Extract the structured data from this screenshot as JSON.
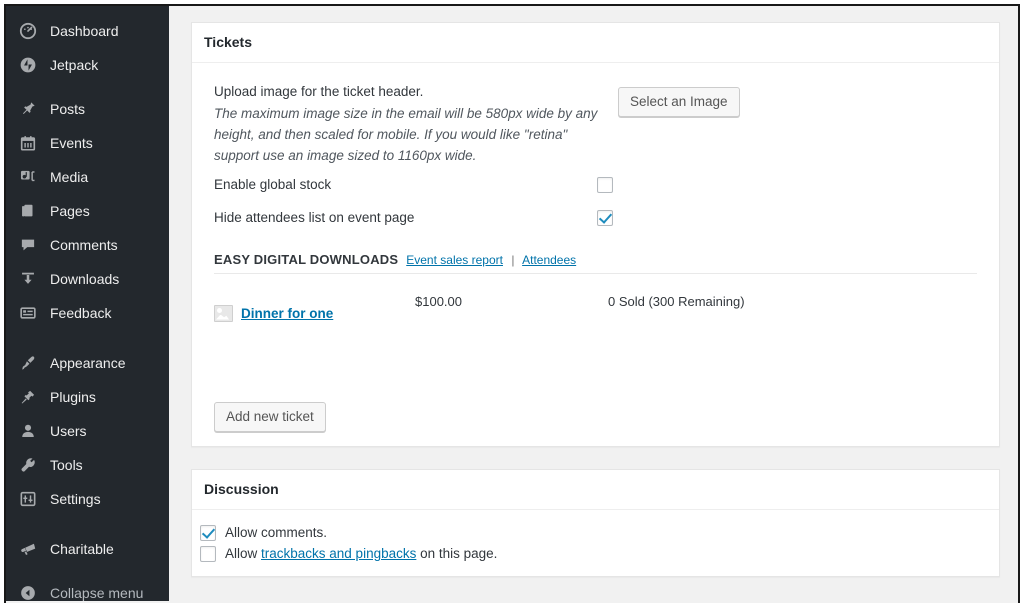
{
  "sidebar": {
    "groups": [
      {
        "items": [
          {
            "label": "Dashboard",
            "icon": "dashboard-icon",
            "name": "sidebar-item-dashboard"
          },
          {
            "label": "Jetpack",
            "icon": "jetpack-icon",
            "name": "sidebar-item-jetpack"
          }
        ]
      },
      {
        "items": [
          {
            "label": "Posts",
            "icon": "pin-icon",
            "name": "sidebar-item-posts"
          },
          {
            "label": "Events",
            "icon": "calendar-icon",
            "name": "sidebar-item-events"
          },
          {
            "label": "Media",
            "icon": "media-icon",
            "name": "sidebar-item-media"
          },
          {
            "label": "Pages",
            "icon": "pages-icon",
            "name": "sidebar-item-pages"
          },
          {
            "label": "Comments",
            "icon": "comment-icon",
            "name": "sidebar-item-comments"
          },
          {
            "label": "Downloads",
            "icon": "download-icon",
            "name": "sidebar-item-downloads"
          },
          {
            "label": "Feedback",
            "icon": "feedback-icon",
            "name": "sidebar-item-feedback"
          }
        ]
      },
      {
        "items": [
          {
            "label": "Appearance",
            "icon": "paintbrush-icon",
            "name": "sidebar-item-appearance"
          },
          {
            "label": "Plugins",
            "icon": "plug-icon",
            "name": "sidebar-item-plugins"
          },
          {
            "label": "Users",
            "icon": "user-icon",
            "name": "sidebar-item-users"
          },
          {
            "label": "Tools",
            "icon": "wrench-icon",
            "name": "sidebar-item-tools"
          },
          {
            "label": "Settings",
            "icon": "sliders-icon",
            "name": "sidebar-item-settings"
          }
        ]
      },
      {
        "items": [
          {
            "label": "Charitable",
            "icon": "megaphone-icon",
            "name": "sidebar-item-charitable"
          }
        ]
      }
    ],
    "collapse": {
      "label": "Collapse menu",
      "icon": "collapse-arrow-icon"
    }
  },
  "tickets_panel": {
    "title": "Tickets",
    "upload": {
      "lead": "Upload image for the ticket header.",
      "description": "The maximum image size in the email will be 580px wide by any height, and then scaled for mobile. If you would like \"retina\" support use an image sized to 1160px wide.",
      "button_label": "Select an Image"
    },
    "options": [
      {
        "label": "Enable global stock",
        "checked": false,
        "name": "enable-global-stock-checkbox"
      },
      {
        "label": "Hide attendees list on event page",
        "checked": true,
        "name": "hide-attendees-list-checkbox"
      }
    ],
    "edd": {
      "title": "EASY DIGITAL DOWNLOADS",
      "links": [
        {
          "label": "Event sales report",
          "name": "event-sales-report-link"
        },
        {
          "label": "Attendees",
          "name": "attendees-link"
        }
      ],
      "separator": "|"
    },
    "ticket": {
      "name": "Dinner for one",
      "price": "$100.00",
      "stock": "0 Sold (300 Remaining)"
    },
    "add_button_label": "Add new ticket"
  },
  "discussion_panel": {
    "title": "Discussion",
    "allow_comments": {
      "label": "Allow comments.",
      "checked": true
    },
    "allow_trackbacks": {
      "prefix": "Allow ",
      "link": "trackbacks and pingbacks",
      "suffix": " on this page.",
      "checked": false
    }
  },
  "colors": {
    "sidebar_bg": "#23282d",
    "link": "#0073aa",
    "checkbox_check": "#1e8cbe",
    "content_bg": "#f1f1f1"
  }
}
